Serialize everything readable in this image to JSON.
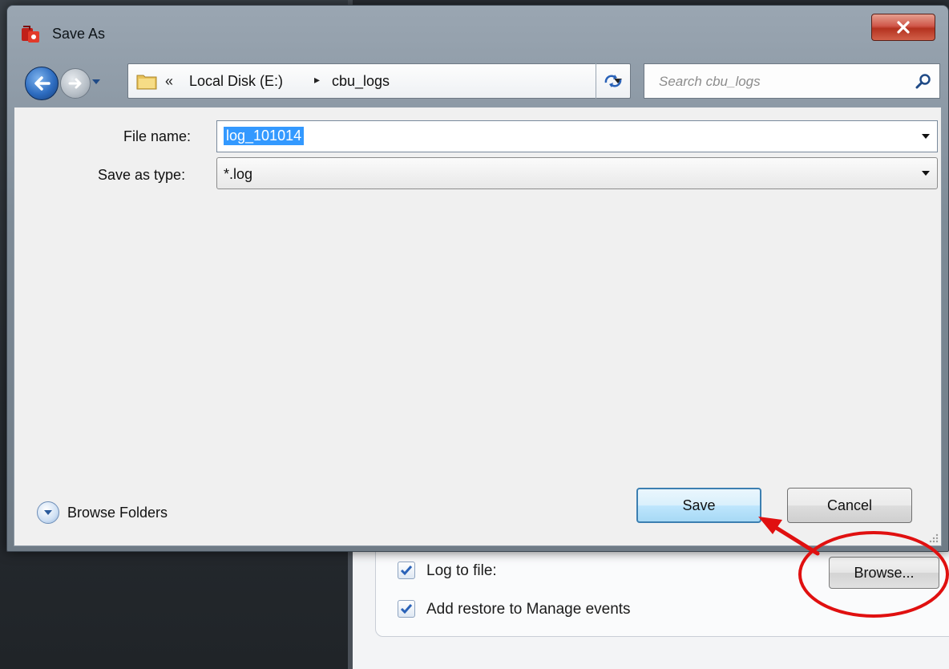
{
  "dialog": {
    "title": "Save As",
    "breadcrumb": {
      "overflow": "«",
      "segments": [
        "Local Disk (E:)",
        "cbu_logs"
      ],
      "separator": "▸"
    },
    "search": {
      "placeholder": "Search cbu_logs"
    },
    "file_name": {
      "label": "File name:",
      "value": "log_101014"
    },
    "save_as_type": {
      "label": "Save as type:",
      "value": "*.log"
    },
    "browse_folders": {
      "label": "Browse Folders"
    },
    "buttons": {
      "save": "Save",
      "cancel": "Cancel"
    }
  },
  "background": {
    "options": [
      {
        "label": "Log to file:",
        "checked": true
      },
      {
        "label": "Add restore to Manage events",
        "checked": true
      }
    ],
    "browse_button": "Browse..."
  },
  "icons": {
    "app": "app-icon",
    "close": "close-icon",
    "back": "back-arrow-icon",
    "forward": "forward-arrow-icon",
    "folder": "folder-icon",
    "refresh": "refresh-icon",
    "search": "search-icon",
    "expand": "chevron-down-icon"
  },
  "colors": {
    "selection": "#3399ff",
    "save_border": "#3c7fb1",
    "annotation": "#e01010",
    "close_button": "#c8453a"
  }
}
